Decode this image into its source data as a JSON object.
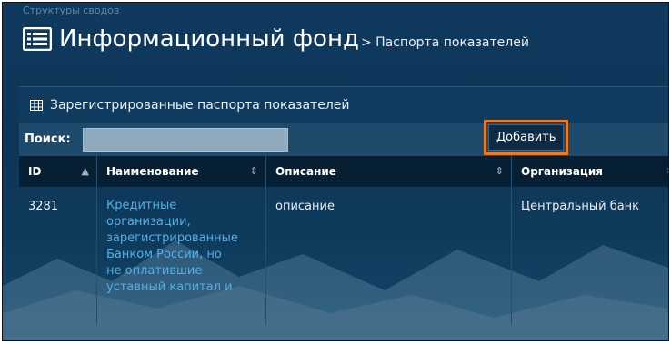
{
  "breadcrumb": "Структуры сводов",
  "title": {
    "main": "Информационный фонд",
    "sub": "> Паспорта показателей"
  },
  "panel": {
    "heading": "Зарегистрированные паспорта показателей"
  },
  "toolbar": {
    "search_label": "Поиск:",
    "search_value": "",
    "add_label": "Добавить"
  },
  "table": {
    "columns": [
      "ID",
      "Наименование",
      "Описание",
      "Организация"
    ],
    "rows": [
      {
        "id": "3281",
        "name_lines": [
          "Кредитные",
          "организации,",
          "зарегистрированные",
          "Банком России, но",
          "не оплатившие",
          "уставный капитал и"
        ],
        "description": "описание",
        "organization": "Центральный банк"
      }
    ]
  },
  "colors": {
    "accent": "#f07a22",
    "link": "#4fb1e8",
    "header_bg": "#071f33"
  }
}
